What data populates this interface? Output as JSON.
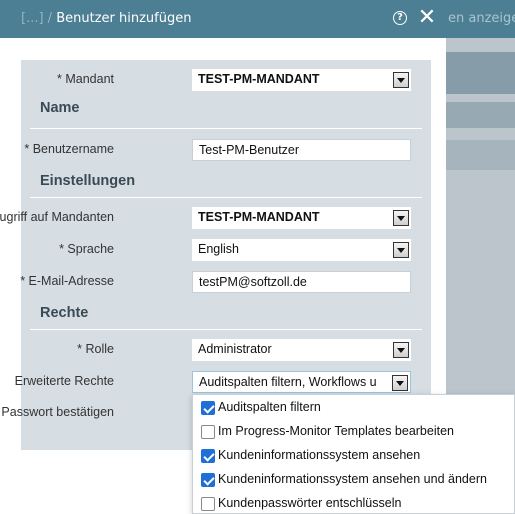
{
  "background": {
    "header_text": "en anzeige"
  },
  "dialog": {
    "title_prefix": "[...] /",
    "title": "Benutzer hinzufügen",
    "help_icon": "help-icon",
    "close_icon": "close-icon"
  },
  "form": {
    "mandant": {
      "label": "* Mandant",
      "value": "TEST-PM-MANDANT"
    },
    "sections": {
      "name": "Name",
      "settings": "Einstellungen",
      "rights": "Rechte"
    },
    "username": {
      "label": "* Benutzername",
      "value": "Test-PM-Benutzer"
    },
    "access": {
      "label": "Zugriff auf Mandanten",
      "value": "TEST-PM-MANDANT"
    },
    "language": {
      "label": "* Sprache",
      "value": "English"
    },
    "email": {
      "label": "* E-Mail-Adresse",
      "value": "testPM@softzoll.de"
    },
    "role": {
      "label": "* Rolle",
      "value": "Administrator"
    },
    "extended_rights": {
      "label": "Erweiterte Rechte",
      "value": "Auditspalten filtern, Workflows u"
    },
    "confirm_password": {
      "label": "Mit Passwort bestätigen"
    }
  },
  "dropdown": {
    "options": [
      {
        "label": "Auditspalten filtern",
        "checked": true
      },
      {
        "label": "Im Progress-Monitor Templates bearbeiten",
        "checked": false
      },
      {
        "label": "Kundeninformationssystem ansehen",
        "checked": true
      },
      {
        "label": "Kundeninformationssystem ansehen und ändern",
        "checked": true
      },
      {
        "label": "Kundenpasswörter entschlüsseln",
        "checked": false
      }
    ]
  },
  "colors": {
    "header": "#4c7f94",
    "panel": "#d6dde3",
    "checkbox": "#1f6fd6"
  }
}
